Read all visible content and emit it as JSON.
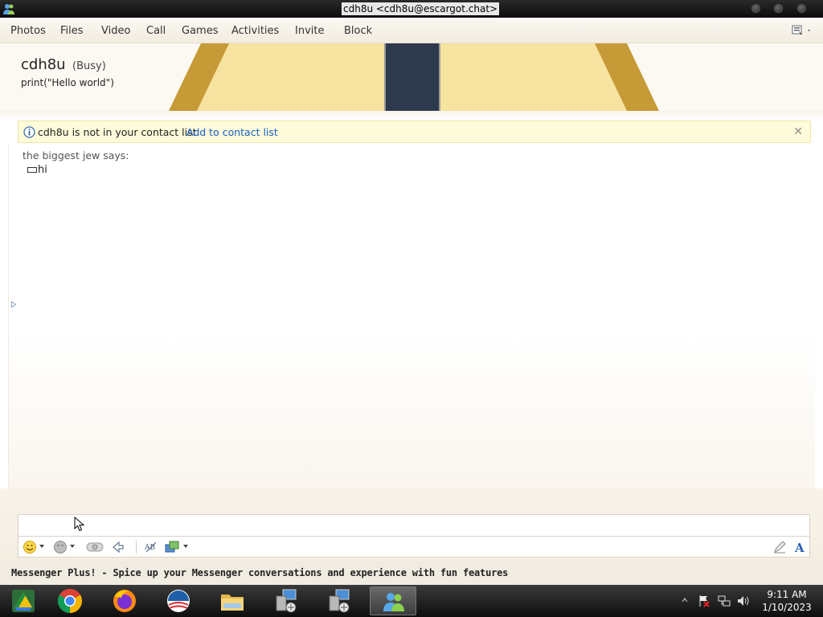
{
  "window": {
    "title": "cdh8u <cdh8u@escargot.chat>"
  },
  "menu": [
    "Photos",
    "Files",
    "Video",
    "Call",
    "Games",
    "Activities",
    "Invite",
    "Block"
  ],
  "contact": {
    "name": "cdh8u",
    "status": "(Busy)",
    "personal_message": "print(\"Hello world\")"
  },
  "infobar": {
    "message": "cdh8u is not in your contact list.",
    "link": "Add to contact list",
    "close": "✕"
  },
  "conversation": {
    "sender": "the biggest jew says:",
    "message": "hi"
  },
  "input": {
    "value": ""
  },
  "plus_banner": "Messenger Plus! - Spice up your Messenger conversations and experience with fun features",
  "taskbar": {
    "apps": [
      "Google Drive",
      "Google Chrome",
      "Firefox",
      "Obama",
      "File Explorer",
      "Network Tool 1",
      "Network Tool 2",
      "Windows Live Messenger"
    ],
    "time": "9:11 AM",
    "date": "1/10/2023"
  }
}
